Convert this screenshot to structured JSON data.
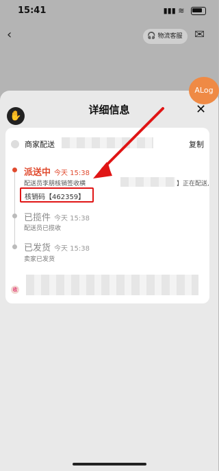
{
  "status_bar": {
    "time": "15:41"
  },
  "header": {
    "back_icon": "chevron-left-icon",
    "service_label": "物流客服",
    "more_icon": "message-icon"
  },
  "sheet": {
    "title": "详细信息",
    "alog_label": "ALog"
  },
  "delivery": {
    "merchant_label": "商家配送",
    "copy_label": "复制"
  },
  "timeline": [
    {
      "status": "派送中",
      "time": "今天 15:38",
      "desc_prefix": "配送员李朋核销签收横",
      "desc_suffix": "】正在配送,",
      "code_text": "核销码【462359】"
    },
    {
      "status": "已揽件",
      "time": "今天 15:38",
      "desc": "配送员已揽收"
    },
    {
      "status": "已发货",
      "time": "今天 15:38",
      "desc": "卖家已发货"
    }
  ],
  "colors": {
    "accent": "#e04a2e",
    "annotation_red": "#e01515",
    "alog_orange": "#ef8a45"
  }
}
